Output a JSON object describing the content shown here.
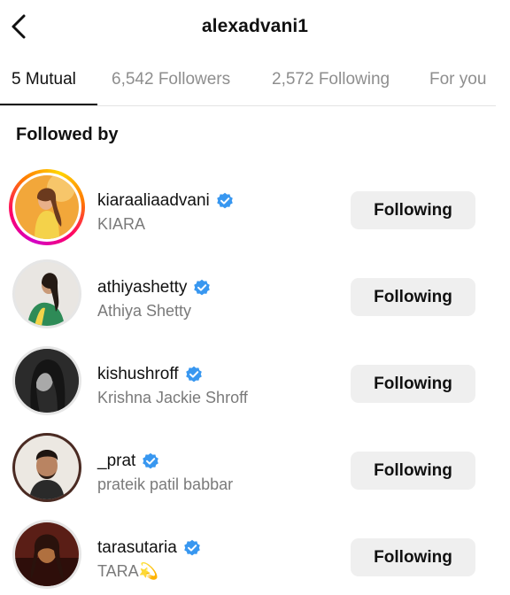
{
  "header": {
    "title": "alexadvani1"
  },
  "tabs": [
    {
      "label": "5 Mutual",
      "active": true
    },
    {
      "label": "6,542 Followers",
      "active": false
    },
    {
      "label": "2,572 Following",
      "active": false
    },
    {
      "label": "For you",
      "active": false
    }
  ],
  "section": {
    "title": "Followed by"
  },
  "users": [
    {
      "username": "kiaraaliaadvani",
      "full_name": "KIARA",
      "button": "Following",
      "verified": true,
      "has_story": true
    },
    {
      "username": "athiyashetty",
      "full_name": "Athiya Shetty",
      "button": "Following",
      "verified": true,
      "has_story": false
    },
    {
      "username": "kishushroff",
      "full_name": "Krishna Jackie Shroff",
      "button": "Following",
      "verified": true,
      "has_story": false
    },
    {
      "username": "_prat",
      "full_name": "prateik patil babbar",
      "button": "Following",
      "verified": true,
      "has_story": false
    },
    {
      "username": "tarasutaria",
      "full_name": "TARA💫",
      "button": "Following",
      "verified": true,
      "has_story": false
    }
  ],
  "colors": {
    "verified_badge": "#3897f0",
    "button_bg": "#efefef",
    "muted_text": "#7a7a7a"
  }
}
